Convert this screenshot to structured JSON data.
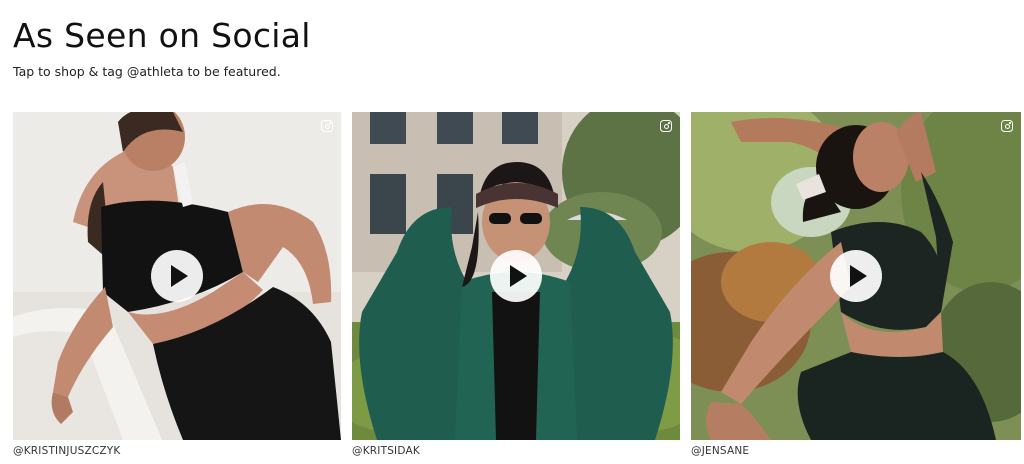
{
  "header": {
    "title": "As Seen on Social",
    "subtitle": "Tap to shop & tag @athleta to be featured."
  },
  "posts": [
    {
      "handle": "@KRISTINJUSZCZYK",
      "media_type": "video",
      "source_icon": "instagram-icon"
    },
    {
      "handle": "@KRITSIDAK",
      "media_type": "video",
      "source_icon": "instagram-icon"
    },
    {
      "handle": "@JENSANE",
      "media_type": "video",
      "source_icon": "instagram-icon"
    }
  ],
  "colors": {
    "text": "#111111",
    "play_button_bg": "#ffffff",
    "play_glyph": "#111111"
  }
}
